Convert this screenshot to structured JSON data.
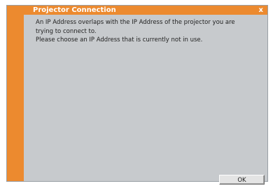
{
  "window": {
    "title": "Projector Connection",
    "close_label": "x"
  },
  "message": {
    "line1": "An IP Address overlaps with the IP Address of the projector you are",
    "line2": "trying to connect to.",
    "line3": "Please choose an IP Address that is currently not in use."
  },
  "buttons": {
    "ok_label": "OK"
  },
  "colors": {
    "accent": "#ec8a2f",
    "body_bg": "#c7cacd"
  }
}
